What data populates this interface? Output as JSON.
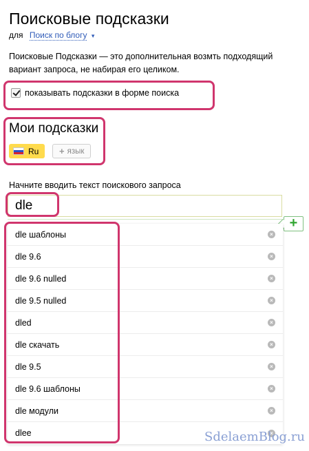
{
  "header": {
    "title": "Поисковые подсказки",
    "scope_prefix": "для",
    "scope_link": "Поиск по блогу",
    "scope_arrow": "▾"
  },
  "description": "Поисковые Подсказки — это дополнительная возмть подходящий вариант запроса, не набирая его целиком.",
  "checkbox": {
    "label": "показывать подсказки в форме поиска",
    "checked": true
  },
  "my_hints": {
    "title": "Мои подсказки",
    "languages": [
      {
        "label": "Ru",
        "active": true
      }
    ],
    "add_language_label": "язык",
    "add_language_icon": "+"
  },
  "query": {
    "label": "Начните вводить текст поискового запроса",
    "value": "dle",
    "add_icon": "+"
  },
  "suggestions": [
    {
      "text": "dle шаблоны"
    },
    {
      "text": "dle 9.6"
    },
    {
      "text": "dle 9.6 nulled"
    },
    {
      "text": "dle 9.5 nulled"
    },
    {
      "text": "dled"
    },
    {
      "text": "dle скачать"
    },
    {
      "text": "dle 9.5"
    },
    {
      "text": "dle 9.6 шаблоны"
    },
    {
      "text": "dle модули"
    },
    {
      "text": "dlee"
    }
  ],
  "delete_icon": "×",
  "watermark": "SdelaemBlog.ru",
  "colors": {
    "highlight": "#d0356d",
    "link": "#2f5bb8",
    "active_lang": "#ffdb4d",
    "add_green": "#2fa52f"
  }
}
